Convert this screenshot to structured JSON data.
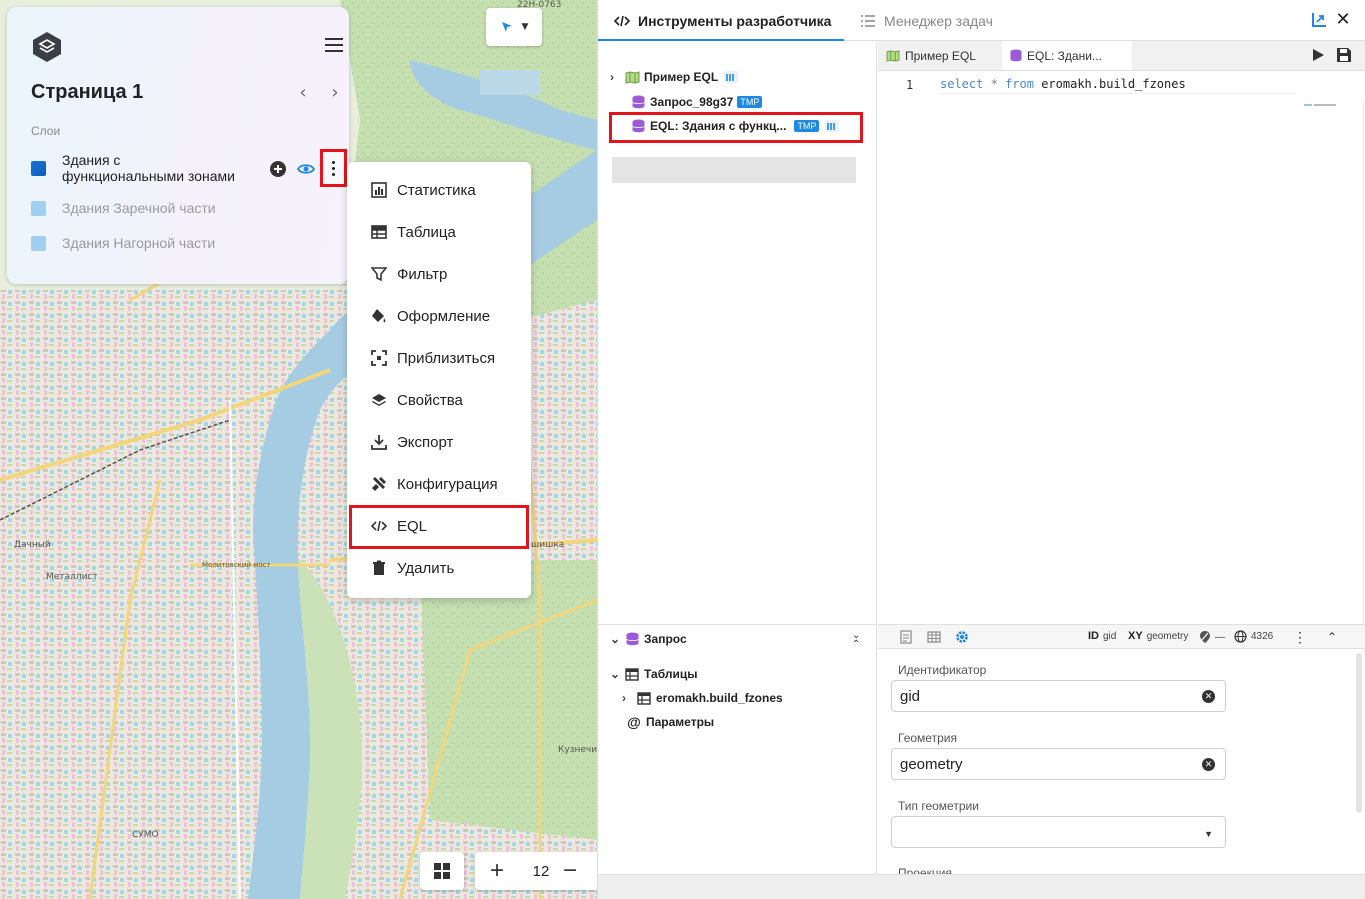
{
  "layers_panel": {
    "page_title": "Страница 1",
    "layers_caption": "Слои",
    "layers": [
      {
        "name": "Здания с функциональными зонами",
        "color": "#1a73d6",
        "enabled": true
      },
      {
        "name": "Здания Заречной части",
        "color": "#9fd0ef",
        "enabled": false
      },
      {
        "name": "Здания Нагорной части",
        "color": "#9fd0ef",
        "enabled": false
      }
    ]
  },
  "context_menu": {
    "items": [
      {
        "label": "Статистика",
        "icon": "bar-chart-icon"
      },
      {
        "label": "Таблица",
        "icon": "table-icon"
      },
      {
        "label": "Фильтр",
        "icon": "filter-icon"
      },
      {
        "label": "Оформление",
        "icon": "paint-bucket-icon"
      },
      {
        "label": "Приблизиться",
        "icon": "zoom-frame-icon"
      },
      {
        "label": "Свойства",
        "icon": "layers-icon"
      },
      {
        "label": "Экспорт",
        "icon": "download-icon"
      },
      {
        "label": "Конфигурация",
        "icon": "tools-icon"
      },
      {
        "label": "EQL",
        "icon": "code-icon"
      },
      {
        "label": "Удалить",
        "icon": "trash-icon"
      }
    ]
  },
  "map": {
    "zoom_level": "12",
    "labels": {
      "road_code": "22Н-0763",
      "district_1": "Дачный",
      "district_2": "Металлист",
      "district_3": "Кузнечи",
      "district_4": "шишка",
      "bridge": "Молитовский мост",
      "sumo": "СУМО"
    }
  },
  "devtools": {
    "tabs": {
      "devtools": "Инструменты разработчика",
      "tasks": "Менеджер задач"
    },
    "tree": {
      "items": [
        {
          "label": "Пример EQL"
        },
        {
          "label": "Запрос_98g37",
          "tag": "TMP"
        },
        {
          "label": "EQL: Здания с функц...",
          "tag": "TMP"
        }
      ]
    },
    "editor": {
      "tab_1": "Пример EQL",
      "tab_2": "EQL: Здани...",
      "line_number": "1",
      "code": {
        "kw_select": "select",
        "op_star": "*",
        "kw_from": "from",
        "table": "eromakh.build_fzones"
      }
    },
    "query_struct": {
      "title": "Запрос",
      "tables_label": "Таблицы",
      "table_name": "eromakh.build_fzones",
      "params_label": "Параметры"
    },
    "props": {
      "toolbar": {
        "id_label": "ID",
        "id_value": "gid",
        "xy_label": "XY",
        "xy_value": "geometry",
        "geom_type": "—",
        "srid": "4326"
      },
      "fields": {
        "id_label": "Идентификатор",
        "id_value": "gid",
        "geom_label": "Геометрия",
        "geom_value": "geometry",
        "geom_type_label": "Тип геометрии",
        "geom_type_value": "",
        "next_label": "Проекция"
      }
    }
  },
  "colors": {
    "accent": "#1e88e5",
    "highlight": "#e3141b",
    "tmp_tag": "#1e88e5"
  }
}
